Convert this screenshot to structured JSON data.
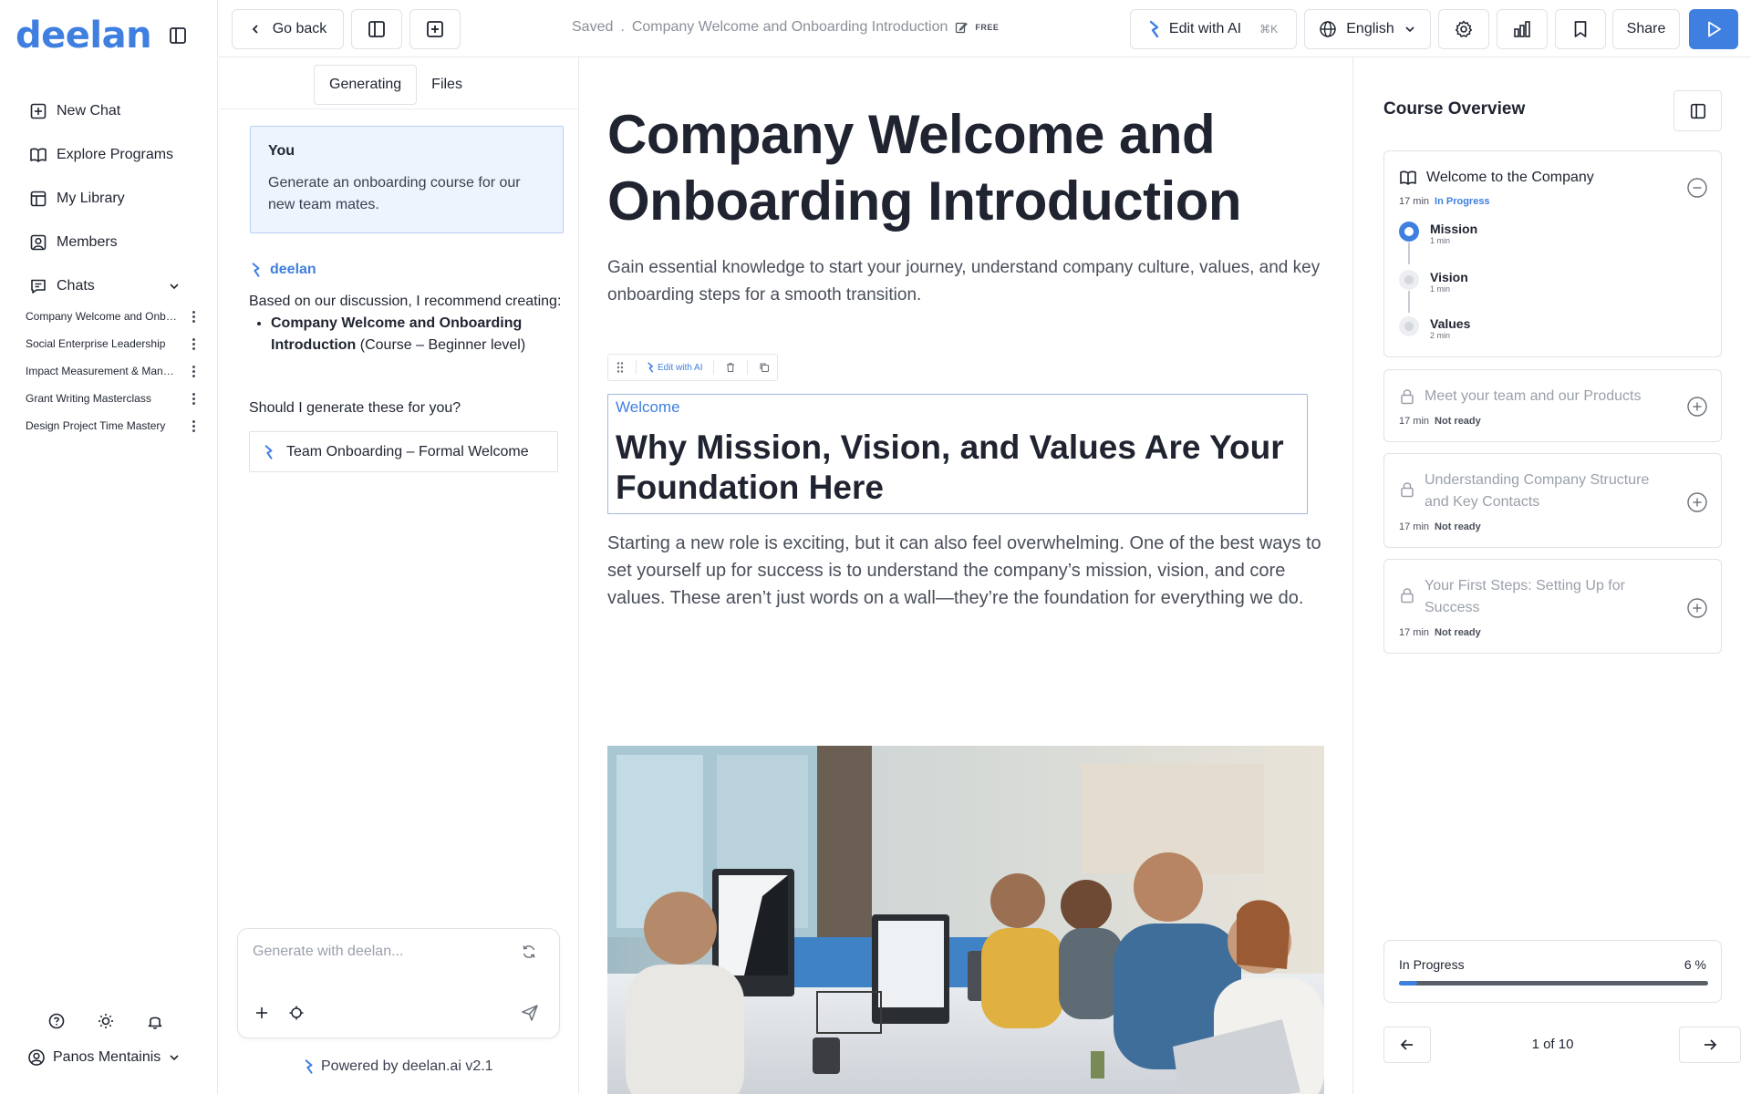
{
  "app": {
    "brand": "deelan"
  },
  "nav": {
    "items": [
      {
        "label": "New Chat",
        "icon": "plus-square-icon"
      },
      {
        "label": "Explore Programs",
        "icon": "book-open-icon"
      },
      {
        "label": "My Library",
        "icon": "library-icon"
      },
      {
        "label": "Members",
        "icon": "user-square-icon"
      }
    ],
    "chats_label": "Chats",
    "chats": [
      "Company Welcome and Onboarding Introduction",
      "Social Enterprise Leadership",
      "Impact Measurement & Management",
      "Grant Writing Masterclass",
      "Design Project Time Mastery"
    ],
    "user": "Panos Mentainis"
  },
  "topbar": {
    "back": "Go back",
    "saved": "Saved",
    "sep": ".",
    "doc_title": "Company Welcome and Onboarding Introduction",
    "plan": "FREE",
    "edit_ai": "Edit with AI",
    "shortcut": "⌘K",
    "language": "English",
    "share": "Share"
  },
  "chat": {
    "tabs": [
      "Generating",
      "Files"
    ],
    "user_label": "You",
    "user_msg": "Generate an onboarding course for our new team mates.",
    "bot_name": "deelan",
    "bot_intro": "Based on our discussion, I recommend creating:",
    "rec_title": "Company Welcome and Onboarding Introduction",
    "rec_suffix": " (Course – Beginner level)",
    "bot_question": "Should I generate these for you?",
    "suggestion": "Team Onboarding – Formal Welcome",
    "input_placeholder": "Generate with deelan...",
    "powered": "Powered by deelan.ai v2.1"
  },
  "content": {
    "title": "Company Welcome and Onboarding Introduction",
    "subtitle": "Gain essential knowledge to start your journey, understand company culture, values, and key onboarding steps for a smooth transition.",
    "toolbar_edit": "Edit with AI",
    "kicker": "Welcome",
    "heading": "Why Mission, Vision, and Values Are Your Foundation Here",
    "paragraph": "Starting a new role is exciting, but it can also feel overwhelming. One of the best ways to set yourself up for success is to understand the company’s mission, vision, and core values. These aren’t just words on a wall—they’re the foundation for everything we do."
  },
  "overview": {
    "title": "Course Overview",
    "modules": [
      {
        "title": "Welcome to the Company",
        "duration": "17 min",
        "status": "In Progress",
        "lessons": [
          {
            "name": "Mission",
            "duration": "1 min"
          },
          {
            "name": "Vision",
            "duration": "1 min"
          },
          {
            "name": "Values",
            "duration": "2 min"
          }
        ]
      },
      {
        "title": "Meet your team and our Products",
        "duration": "17 min",
        "status": "Not ready"
      },
      {
        "title": "Understanding Company Structure and Key Contacts",
        "duration": "17 min",
        "status": "Not ready"
      },
      {
        "title": "Your First Steps: Setting Up for Success",
        "duration": "17 min",
        "status": "Not ready"
      }
    ],
    "progress_label": "In Progress",
    "progress_text": "6 %",
    "progress_value": 6,
    "pager": "1 of 10"
  },
  "colors": {
    "accent": "#3f7fe0",
    "accent_light": "#eef4fd",
    "border": "#dfe2e7"
  }
}
